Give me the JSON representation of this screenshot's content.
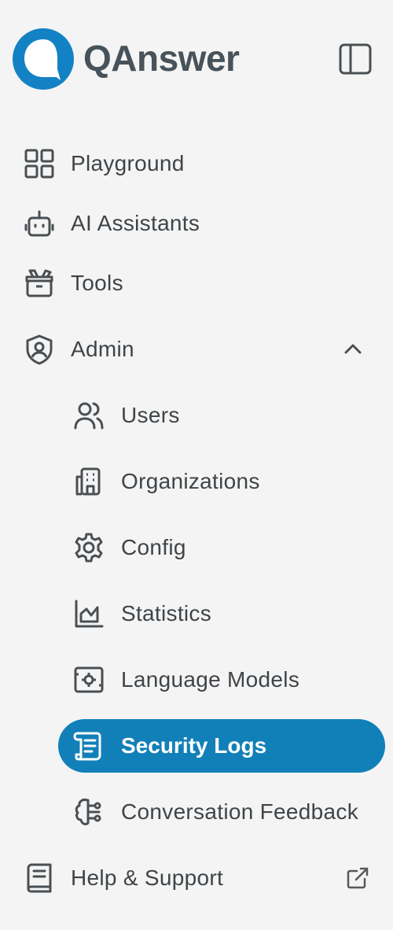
{
  "brand": {
    "name": "QAnswer",
    "color": "#1282c4"
  },
  "nav": {
    "playground": "Playground",
    "ai_assistants": "AI Assistants",
    "tools": "Tools",
    "admin": "Admin",
    "help_support": "Help & Support"
  },
  "admin_submenu": {
    "expanded": true,
    "users": "Users",
    "organizations": "Organizations",
    "config": "Config",
    "statistics": "Statistics",
    "language_models": "Language Models",
    "security_logs": "Security Logs",
    "conversation_feedback": "Conversation Feedback"
  },
  "active_item": "Security Logs",
  "colors": {
    "active_bg": "#1280b8",
    "text": "#3f4448",
    "background": "#f4f4f4"
  },
  "icons": {
    "playground": "grid-icon",
    "ai_assistants": "robot-icon",
    "tools": "toolbox-icon",
    "admin": "shield-user-icon",
    "users": "users-icon",
    "organizations": "building-icon",
    "config": "gear-icon",
    "statistics": "chart-area-icon",
    "language_models": "cpu-icon",
    "security_logs": "scroll-icon",
    "conversation_feedback": "brain-icon",
    "help_support": "book-icon"
  }
}
